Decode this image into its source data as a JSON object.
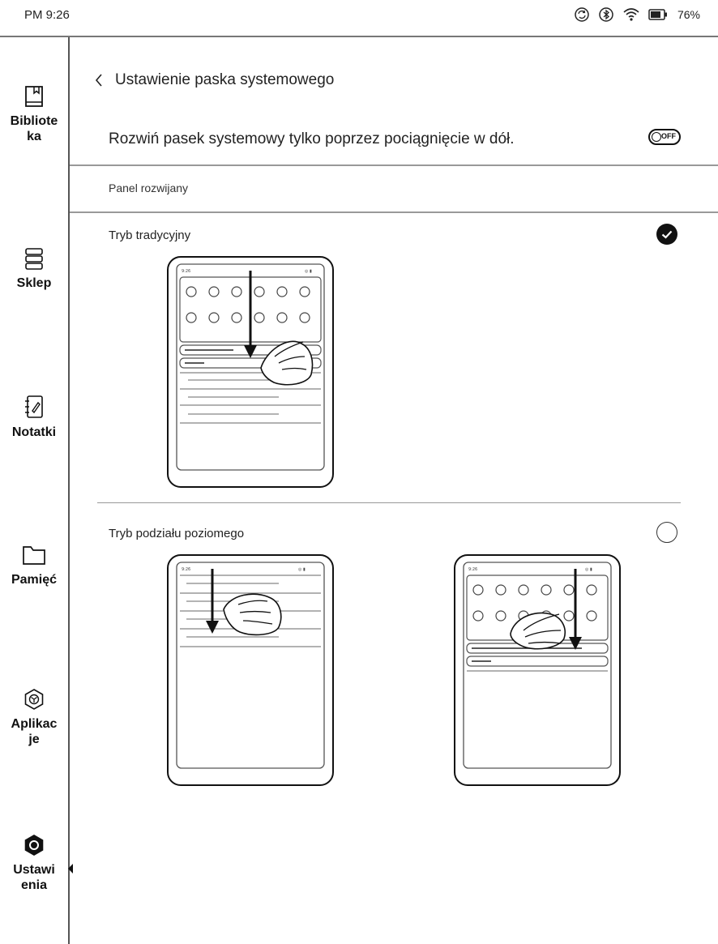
{
  "status_bar": {
    "time": "PM 9:26",
    "battery": "76%",
    "icons": [
      "sync-icon",
      "bluetooth-icon",
      "wifi-icon",
      "battery-icon"
    ]
  },
  "sidebar": {
    "items": [
      {
        "label": "Bibliote\nka",
        "icon": "book-icon"
      },
      {
        "label": "Sklep",
        "icon": "shop-icon"
      },
      {
        "label": "Notatki",
        "icon": "notes-icon"
      },
      {
        "label": "Pamięć",
        "icon": "folder-icon"
      },
      {
        "label": "Aplikac\nje",
        "icon": "apps-icon"
      },
      {
        "label": "Ustawi\nenia",
        "icon": "settings-icon",
        "active": true
      }
    ]
  },
  "header": {
    "title": "Ustawienie paska systemowego"
  },
  "setting": {
    "label": "Rozwiń pasek systemowy tylko poprzez pociągnięcie w dół.",
    "toggle_state": "OFF"
  },
  "section": {
    "label": "Panel rozwijany"
  },
  "options": [
    {
      "title": "Tryb tradycyjny",
      "selected": true
    },
    {
      "title": "Tryb podziału poziomego",
      "selected": false
    }
  ],
  "colors": {
    "ink": "#111111",
    "divider": "#999999",
    "background": "#ffffff"
  }
}
